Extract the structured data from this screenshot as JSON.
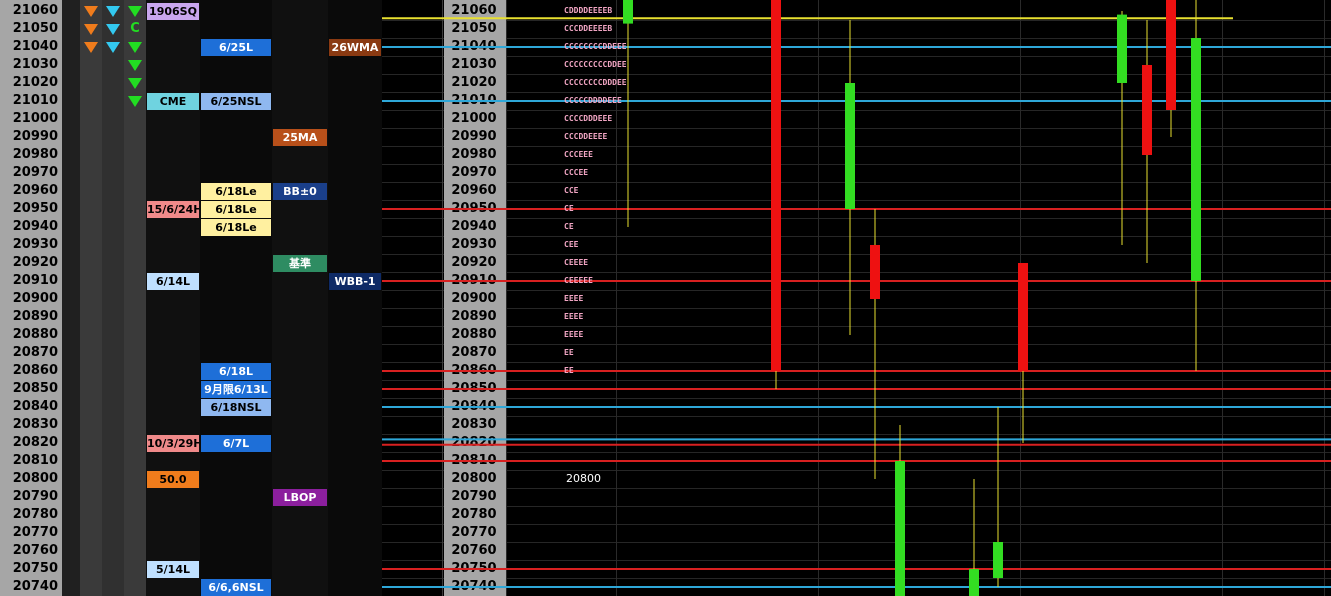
{
  "price_ladder": {
    "prices": [
      "21060",
      "21050",
      "21040",
      "21030",
      "21020",
      "21010",
      "21000",
      "20990",
      "20980",
      "20970",
      "20960",
      "20950",
      "20940",
      "20930",
      "20920",
      "20910",
      "20900",
      "20890",
      "20880",
      "20870",
      "20860",
      "20850",
      "20840",
      "20830",
      "20820",
      "20810",
      "20800",
      "20790",
      "20780",
      "20770",
      "20760",
      "20750",
      "20740"
    ]
  },
  "signals": {
    "col1": [
      {
        "row": 0,
        "type": "down",
        "color": "#f07c1c"
      },
      {
        "row": 1,
        "type": "down",
        "color": "#f07c1c"
      },
      {
        "row": 2,
        "type": "down",
        "color": "#f07c1c"
      }
    ],
    "col2": [
      {
        "row": 0,
        "type": "down",
        "color": "#33c9f0"
      },
      {
        "row": 1,
        "type": "down",
        "color": "#33c9f0"
      },
      {
        "row": 2,
        "type": "down",
        "color": "#33c9f0"
      }
    ],
    "col3": [
      {
        "row": 0,
        "type": "down",
        "color": "#22dd22"
      },
      {
        "row": 1,
        "type": "text",
        "text": "C",
        "color": "#22dd22"
      },
      {
        "row": 2,
        "type": "down",
        "color": "#22dd22"
      },
      {
        "row": 3,
        "type": "down",
        "color": "#22dd22"
      },
      {
        "row": 4,
        "type": "down",
        "color": "#22dd22"
      },
      {
        "row": 5,
        "type": "down",
        "color": "#22dd22"
      }
    ]
  },
  "levels_col_a": [
    {
      "row": 0,
      "text": "1906SQ",
      "bg": "#c9a6ee",
      "fg": "#000000"
    },
    {
      "row": 5,
      "text": "CME",
      "bg": "#6fd3e0",
      "fg": "#000000"
    },
    {
      "row": 11,
      "text": "15/6/24H",
      "bg": "#f08a8a",
      "fg": "#000000"
    },
    {
      "row": 15,
      "text": "6/14L",
      "bg": "#bfe0ff",
      "fg": "#000000"
    },
    {
      "row": 24,
      "text": "10/3/29H",
      "bg": "#f08a8a",
      "fg": "#000000"
    },
    {
      "row": 26,
      "text": "50.0",
      "bg": "#f07c1c",
      "fg": "#000000"
    },
    {
      "row": 31,
      "text": "5/14L",
      "bg": "#bfe0ff",
      "fg": "#000000"
    }
  ],
  "levels_col_b": [
    {
      "row": 2,
      "text": "6/25L",
      "bg": "#1e6fd8",
      "fg": "#ffffff"
    },
    {
      "row": 5,
      "text": "6/25NSL",
      "bg": "#8fb8f0",
      "fg": "#000000"
    },
    {
      "row": 10,
      "text": "6/18Le",
      "bg": "#fff0a0",
      "fg": "#000000"
    },
    {
      "row": 11,
      "text": "6/18Le",
      "bg": "#fff0a0",
      "fg": "#000000"
    },
    {
      "row": 12,
      "text": "6/18Le",
      "bg": "#fff0a0",
      "fg": "#000000"
    },
    {
      "row": 20,
      "text": "6/18L",
      "bg": "#1e6fd8",
      "fg": "#ffffff"
    },
    {
      "row": 21,
      "text": "9月限6/13L",
      "bg": "#1e6fd8",
      "fg": "#ffffff"
    },
    {
      "row": 22,
      "text": "6/18NSL",
      "bg": "#8fb8f0",
      "fg": "#000000"
    },
    {
      "row": 24,
      "text": "6/7L",
      "bg": "#1e6fd8",
      "fg": "#ffffff"
    },
    {
      "row": 32,
      "text": "6/6,6NSL",
      "bg": "#1e6fd8",
      "fg": "#ffffff"
    }
  ],
  "levels_col_c": [
    {
      "row": 7,
      "text": "25MA",
      "bg": "#b8501a",
      "fg": "#ffffff"
    },
    {
      "row": 10,
      "text": "BB±0",
      "bg": "#1a3f8a",
      "fg": "#ffffff"
    },
    {
      "row": 14,
      "text": "基準",
      "bg": "#2e8c62",
      "fg": "#ffffff"
    },
    {
      "row": 27,
      "text": "LBOP",
      "bg": "#8c1f9e",
      "fg": "#ffffff"
    }
  ],
  "levels_col_d": [
    {
      "row": 2,
      "text": "26WMA",
      "bg": "#8a3a12",
      "fg": "#ffffff"
    },
    {
      "row": 15,
      "text": "WBB-1",
      "bg": "#0e2a66",
      "fg": "#ffffff"
    }
  ],
  "tpo_profile": [
    {
      "row": 0,
      "text": "CDDDDEEEEB"
    },
    {
      "row": 1,
      "text": "CCCDDEEEEB"
    },
    {
      "row": 2,
      "text": "CCCCCCCCDDEEE"
    },
    {
      "row": 3,
      "text": "CCCCCCCCCDDEE"
    },
    {
      "row": 4,
      "text": "CCCCCCCCDDDEE"
    },
    {
      "row": 5,
      "text": "CCCCCDDDDEEE"
    },
    {
      "row": 6,
      "text": "CCCCDDDEEE"
    },
    {
      "row": 7,
      "text": "CCCDDEEEE"
    },
    {
      "row": 8,
      "text": "CCCEEE"
    },
    {
      "row": 9,
      "text": "CCCEE"
    },
    {
      "row": 10,
      "text": "CCE"
    },
    {
      "row": 11,
      "text": "CE"
    },
    {
      "row": 12,
      "text": "CE"
    },
    {
      "row": 13,
      "text": "CEE"
    },
    {
      "row": 14,
      "text": "CEEEE"
    },
    {
      "row": 15,
      "text": "CEEEEE"
    },
    {
      "row": 16,
      "text": "EEEE"
    },
    {
      "row": 17,
      "text": "EEEE"
    },
    {
      "row": 18,
      "text": "EEEE"
    },
    {
      "row": 19,
      "text": "EE"
    },
    {
      "row": 20,
      "text": "EE"
    }
  ],
  "chart_label": "20800",
  "chart_data": {
    "type": "candlestick",
    "ylim": [
      20735,
      21065
    ],
    "tick_step": 10,
    "horizontal_lines": [
      {
        "price": 21056,
        "color": "#e8e030"
      },
      {
        "price": 21040,
        "color": "#2ea7d8"
      },
      {
        "price": 21010,
        "color": "#2ea7d8"
      },
      {
        "price": 20950,
        "color": "#d82020"
      },
      {
        "price": 20910,
        "color": "#d82020"
      },
      {
        "price": 20860,
        "color": "#d82020"
      },
      {
        "price": 20850,
        "color": "#d82020"
      },
      {
        "price": 20840,
        "color": "#2ea7d8"
      },
      {
        "price": 20822,
        "color": "#2ea7d8"
      },
      {
        "price": 20819,
        "color": "#d82020"
      },
      {
        "price": 20810,
        "color": "#d82020"
      },
      {
        "price": 20750,
        "color": "#d82020"
      },
      {
        "price": 20740,
        "color": "#2ea7d8"
      }
    ],
    "candles": [
      {
        "open": 21053,
        "close": 21070,
        "high": 21080,
        "low": 20940,
        "color": "#33dd22"
      },
      {
        "open": 21070,
        "close": 20860,
        "high": 21070,
        "low": 20850,
        "color": "#ee1111"
      },
      {
        "open": 20950,
        "close": 21020,
        "high": 21055,
        "low": 20880,
        "color": "#33dd22"
      },
      {
        "open": 20930,
        "close": 20900,
        "high": 20950,
        "low": 20800,
        "color": "#ee1111"
      },
      {
        "open": 20710,
        "close": 20810,
        "high": 20830,
        "low": 20700,
        "color": "#33dd22"
      },
      {
        "open": 20705,
        "close": 20750,
        "high": 20800,
        "low": 20700,
        "color": "#33dd22"
      },
      {
        "open": 20745,
        "close": 20765,
        "high": 20840,
        "low": 20740,
        "color": "#33dd22"
      },
      {
        "open": 20920,
        "close": 20860,
        "high": 20920,
        "low": 20820,
        "color": "#ee1111"
      },
      {
        "open": 21020,
        "close": 21058,
        "high": 21060,
        "low": 20930,
        "color": "#33dd22"
      },
      {
        "open": 21030,
        "close": 20980,
        "high": 21055,
        "low": 20920,
        "color": "#ee1111"
      },
      {
        "open": 21070,
        "close": 21005,
        "high": 21070,
        "low": 20990,
        "color": "#ee1111"
      },
      {
        "open": 20910,
        "close": 21045,
        "high": 21070,
        "low": 20860,
        "color": "#33dd22"
      }
    ]
  }
}
